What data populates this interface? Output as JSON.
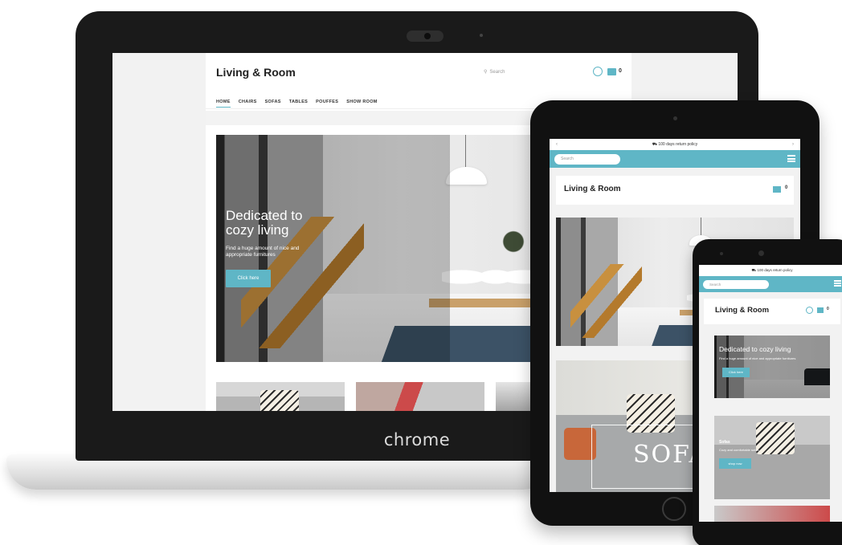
{
  "laptop": {
    "brand": "chrome",
    "site": {
      "logo": "Living & Room",
      "search_placeholder": "Search",
      "cart_count": "0",
      "nav": [
        "HOME",
        "CHAIRS",
        "SOFAS",
        "TABLES",
        "POUFFES",
        "SHOW ROOM"
      ],
      "active_nav_index": 0,
      "hero": {
        "title": "Dedicated to cozy living",
        "subtitle": "Find a huge amount of nice and appropriate furnitures",
        "button": "Click here"
      }
    }
  },
  "tablet": {
    "topbar": "100 days return policy",
    "search_placeholder": "Search",
    "logo": "Living & Room",
    "cart_count": "0",
    "card_label": "SOFA"
  },
  "phone": {
    "topbar": "100 days return policy",
    "search_placeholder": "Search",
    "logo": "Living & Room",
    "cart_count": "0",
    "hero": {
      "title": "Dedicated to cozy living",
      "subtitle": "Find a huge amount of nice and appropriate furnitures",
      "button": "Click here"
    },
    "card": {
      "title": "Sofas",
      "subtitle": "Cozy and comfortable sofas",
      "button": "shop now"
    }
  },
  "colors": {
    "accent": "#5fb6c6",
    "device": "#111111",
    "page_bg": "#f2f2f2"
  }
}
